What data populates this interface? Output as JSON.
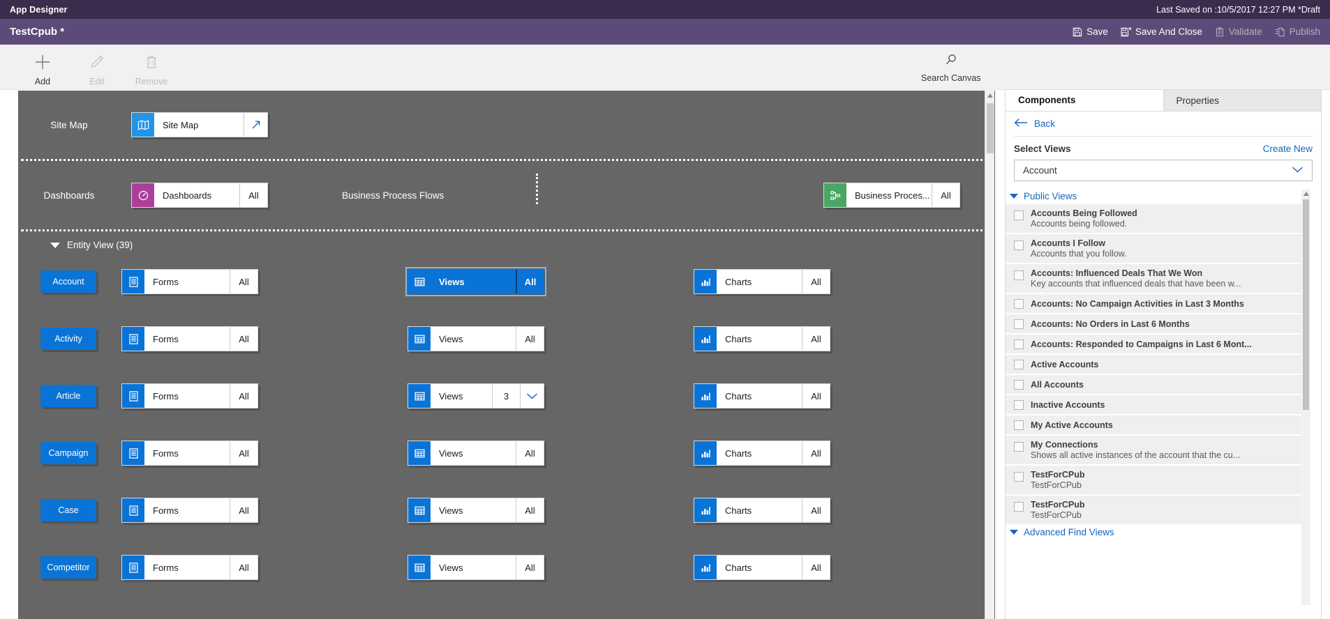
{
  "titlebar": {
    "app_title": "App Designer",
    "last_saved": "Last Saved on :10/5/2017 12:27 PM *Draft"
  },
  "commandbar": {
    "doc_title": "TestCpub *",
    "actions": [
      {
        "label": "Save",
        "icon": "save-icon",
        "disabled": false
      },
      {
        "label": "Save And Close",
        "icon": "save-and-close-icon",
        "disabled": false
      },
      {
        "label": "Validate",
        "icon": "validate-icon",
        "disabled": true
      },
      {
        "label": "Publish",
        "icon": "publish-icon",
        "disabled": true
      }
    ]
  },
  "ribbon": {
    "buttons": [
      {
        "label": "Add",
        "icon": "plus-icon",
        "disabled": false
      },
      {
        "label": "Edit",
        "icon": "pencil-icon",
        "disabled": true
      },
      {
        "label": "Remove",
        "icon": "trash-icon",
        "disabled": true
      }
    ],
    "search": {
      "label": "Search Canvas",
      "icon": "search-icon"
    }
  },
  "canvas": {
    "sitemap_section": {
      "label": "Site Map",
      "tile": {
        "name": "Site Map",
        "icon": "sitemap-icon",
        "icon_color": "#2295e8",
        "open_icon": "open-arrow-icon"
      }
    },
    "dashboards_section": {
      "label": "Dashboards",
      "tile": {
        "name": "Dashboards",
        "count": "All",
        "icon": "dashboard-icon",
        "icon_color": "#ad3f9b"
      }
    },
    "bpf_section": {
      "label": "Business Process Flows",
      "tile": {
        "name": "Business Proces...",
        "count": "All",
        "icon": "bpf-icon",
        "icon_color": "#4aa664"
      }
    },
    "entity_view": {
      "header": "Entity View (39)",
      "column_icons": {
        "forms": "forms-icon",
        "views": "views-icon",
        "charts": "charts-icon"
      },
      "rows": [
        {
          "entity": "Account",
          "forms": {
            "label": "Forms",
            "count": "All"
          },
          "views": {
            "label": "Views",
            "count": "All",
            "selected": true,
            "chevron": false
          },
          "charts": {
            "label": "Charts",
            "count": "All"
          }
        },
        {
          "entity": "Activity",
          "forms": {
            "label": "Forms",
            "count": "All"
          },
          "views": {
            "label": "Views",
            "count": "All",
            "selected": false,
            "chevron": false
          },
          "charts": {
            "label": "Charts",
            "count": "All"
          }
        },
        {
          "entity": "Article",
          "forms": {
            "label": "Forms",
            "count": "All"
          },
          "views": {
            "label": "Views",
            "count": "3",
            "selected": false,
            "chevron": true
          },
          "charts": {
            "label": "Charts",
            "count": "All"
          }
        },
        {
          "entity": "Campaign",
          "forms": {
            "label": "Forms",
            "count": "All"
          },
          "views": {
            "label": "Views",
            "count": "All",
            "selected": false,
            "chevron": false
          },
          "charts": {
            "label": "Charts",
            "count": "All"
          }
        },
        {
          "entity": "Case",
          "forms": {
            "label": "Forms",
            "count": "All"
          },
          "views": {
            "label": "Views",
            "count": "All",
            "selected": false,
            "chevron": false
          },
          "charts": {
            "label": "Charts",
            "count": "All"
          }
        },
        {
          "entity": "Competitor",
          "forms": {
            "label": "Forms",
            "count": "All"
          },
          "views": {
            "label": "Views",
            "count": "All",
            "selected": false,
            "chevron": false
          },
          "charts": {
            "label": "Charts",
            "count": "All"
          }
        }
      ]
    }
  },
  "right_panel": {
    "tabs": [
      {
        "label": "Components",
        "active": true
      },
      {
        "label": "Properties",
        "active": false
      }
    ],
    "back_label": "Back",
    "section_label": "Select Views",
    "create_new_label": "Create New",
    "entity_select_value": "Account",
    "groups": [
      {
        "title": "Public Views",
        "expanded": true,
        "items": [
          {
            "title": "Accounts Being Followed",
            "desc": "Accounts being followed.",
            "checked": false
          },
          {
            "title": "Accounts I Follow",
            "desc": "Accounts that you follow.",
            "checked": false
          },
          {
            "title": "Accounts: Influenced Deals That We Won",
            "desc": "Key accounts that influenced deals that have been w...",
            "checked": false
          },
          {
            "title": "Accounts: No Campaign Activities in Last 3 Months",
            "desc": "",
            "checked": false
          },
          {
            "title": "Accounts: No Orders in Last 6 Months",
            "desc": "",
            "checked": false
          },
          {
            "title": "Accounts: Responded to Campaigns in Last 6 Mont...",
            "desc": "",
            "checked": false
          },
          {
            "title": "Active Accounts",
            "desc": "",
            "checked": false
          },
          {
            "title": "All Accounts",
            "desc": "",
            "checked": false
          },
          {
            "title": "Inactive Accounts",
            "desc": "",
            "checked": false
          },
          {
            "title": "My Active Accounts",
            "desc": "",
            "checked": false
          },
          {
            "title": "My Connections",
            "desc": "Shows all active instances of the account that the cu...",
            "checked": false
          },
          {
            "title": "TestForCPub",
            "desc": "TestForCPub",
            "checked": false
          },
          {
            "title": "TestForCPub",
            "desc": "TestForCPub",
            "checked": false
          }
        ]
      },
      {
        "title": "Advanced Find Views",
        "expanded": true,
        "items": []
      }
    ]
  },
  "colors": {
    "titlebar": "#3b2c4e",
    "commandbar": "#5c4b78",
    "canvas": "#666666",
    "accent_blue": "#0a74d6",
    "link_blue": "#1565c0",
    "sitemap_icon": "#2295e8",
    "dashboard_icon": "#ad3f9b",
    "bpf_icon": "#4aa664"
  }
}
